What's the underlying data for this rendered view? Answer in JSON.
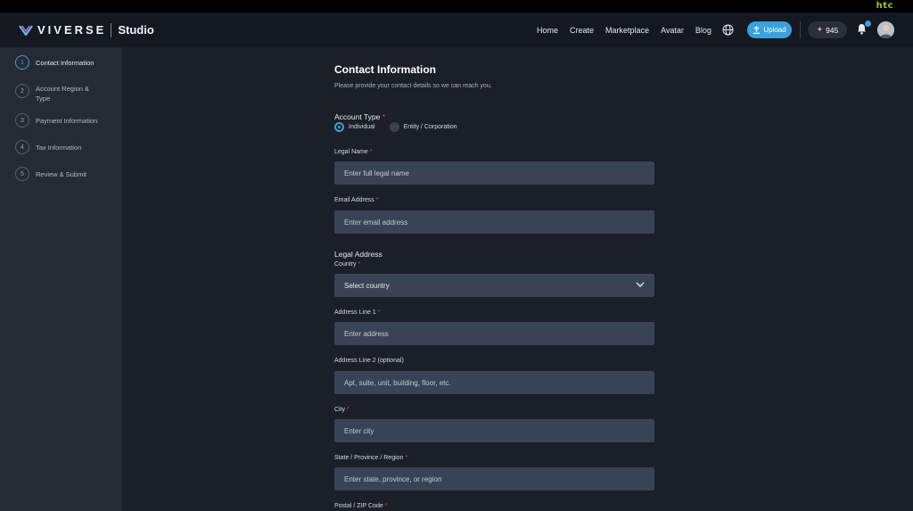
{
  "htc_brand": "htc",
  "brand": {
    "name": "VIVERSE",
    "product": "Studio"
  },
  "nav": {
    "links": [
      "Home",
      "Create",
      "Marketplace",
      "Avatar",
      "Blog"
    ],
    "upload_label": "Upload",
    "points": "945"
  },
  "sidebar": {
    "steps": [
      {
        "num": "1",
        "label": "Contact Information"
      },
      {
        "num": "2",
        "label": "Account Region & Type"
      },
      {
        "num": "3",
        "label": "Payment Information"
      },
      {
        "num": "4",
        "label": "Tax Information"
      },
      {
        "num": "5",
        "label": "Review & Submit"
      }
    ]
  },
  "form": {
    "title": "Contact Information",
    "subtitle": "Please provide your contact details so we can reach you.",
    "account_type_label": "Account Type",
    "account_type_options": [
      "Individual",
      "Entity / Corporation"
    ],
    "required_mark": "*",
    "legal_name": {
      "label": "Legal Name",
      "placeholder": "Enter full legal name"
    },
    "email": {
      "label": "Email Address",
      "placeholder": "Enter email address"
    },
    "legal_address_heading": "Legal Address",
    "country": {
      "label": "Country",
      "value": "Select country"
    },
    "address1": {
      "label": "Address Line 1",
      "placeholder": "Enter address"
    },
    "address2": {
      "label": "Address Line 2 (optional)",
      "placeholder": "Apt, suite, unit, building, floor, etc."
    },
    "city": {
      "label": "City",
      "placeholder": "Enter city"
    },
    "state": {
      "label": "State / Province / Region",
      "placeholder": "Enter state, province, or region"
    },
    "postal": {
      "label": "Postal / ZIP Code"
    }
  },
  "colors": {
    "accent": "#3d9fdc",
    "required": "#e5484d",
    "background": "#1b1f28",
    "sidebar": "#252a35",
    "input": "#3a4255"
  }
}
